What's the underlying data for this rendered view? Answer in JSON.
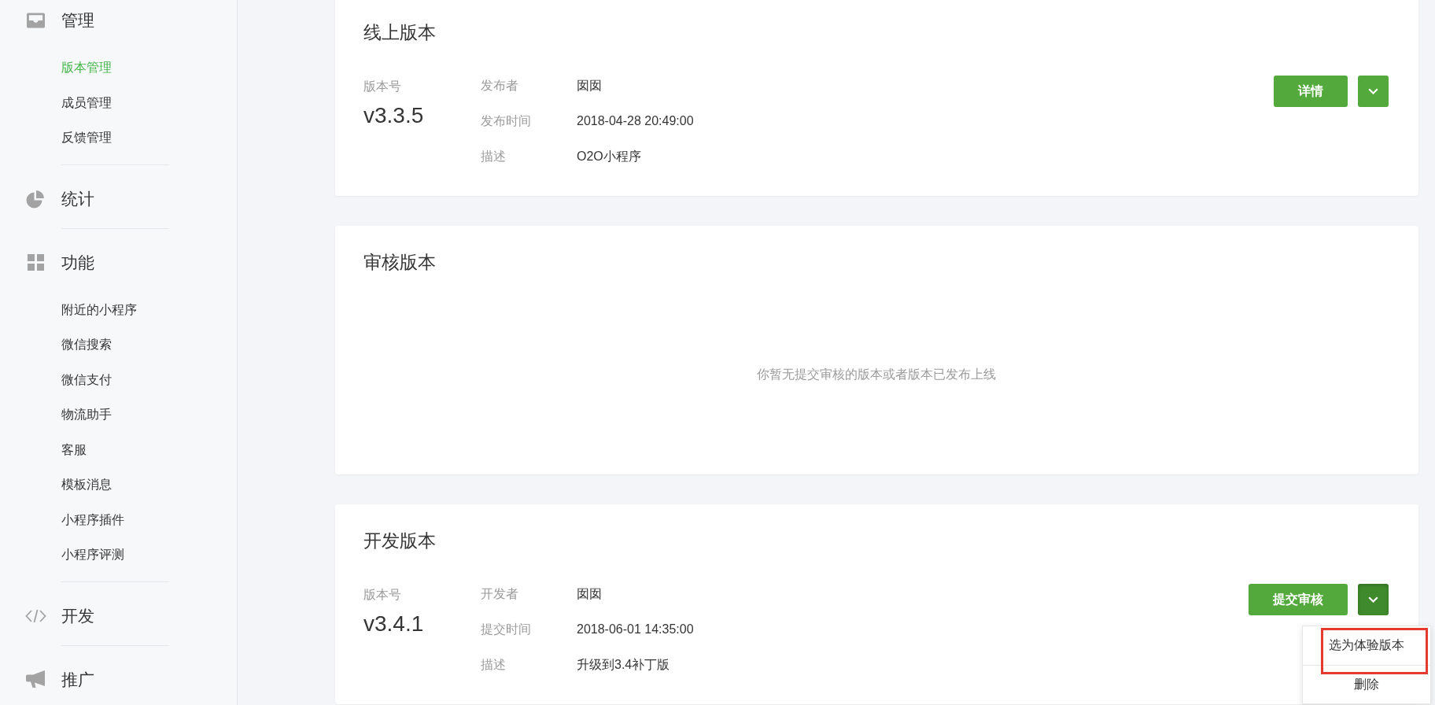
{
  "sidebar": {
    "sections": [
      {
        "title": "管理",
        "items": [
          {
            "label": "版本管理",
            "selected": true
          },
          {
            "label": "成员管理",
            "selected": false
          },
          {
            "label": "反馈管理",
            "selected": false
          }
        ]
      },
      {
        "title": "统计"
      },
      {
        "title": "功能",
        "items": [
          {
            "label": "附近的小程序",
            "selected": false
          },
          {
            "label": "微信搜索",
            "selected": false
          },
          {
            "label": "微信支付",
            "selected": false
          },
          {
            "label": "物流助手",
            "selected": false
          },
          {
            "label": "客服",
            "selected": false
          },
          {
            "label": "模板消息",
            "selected": false
          },
          {
            "label": "小程序插件",
            "selected": false
          },
          {
            "label": "小程序评测",
            "selected": false
          }
        ]
      },
      {
        "title": "开发"
      },
      {
        "title": "推广"
      }
    ]
  },
  "cards": [
    {
      "kind": "details",
      "title": "线上版本",
      "version_label": "版本号",
      "version": "v3.3.5",
      "fields": [
        {
          "label": "发布者",
          "value": "囡囡"
        },
        {
          "label": "发布时间",
          "value": "2018-04-28 20:49:00"
        },
        {
          "label": "描述",
          "value": "O2O小程序"
        }
      ],
      "primary_button": "详情",
      "menu_toggle": {
        "expanded": false
      }
    },
    {
      "kind": "empty",
      "title": "审核版本",
      "message": "你暂无提交审核的版本或者版本已发布上线"
    },
    {
      "kind": "details",
      "title": "开发版本",
      "version_label": "版本号",
      "version": "v3.4.1",
      "fields": [
        {
          "label": "开发者",
          "value": "囡囡"
        },
        {
          "label": "提交时间",
          "value": "2018-06-01 14:35:00"
        },
        {
          "label": "描述",
          "value": "升级到3.4补丁版"
        }
      ],
      "primary_button": "提交审核",
      "menu_toggle": {
        "expanded": true,
        "menu": [
          {
            "label": "选为体验版本",
            "highlighted": true
          },
          {
            "label": "删除",
            "highlighted": false
          }
        ]
      }
    }
  ]
}
